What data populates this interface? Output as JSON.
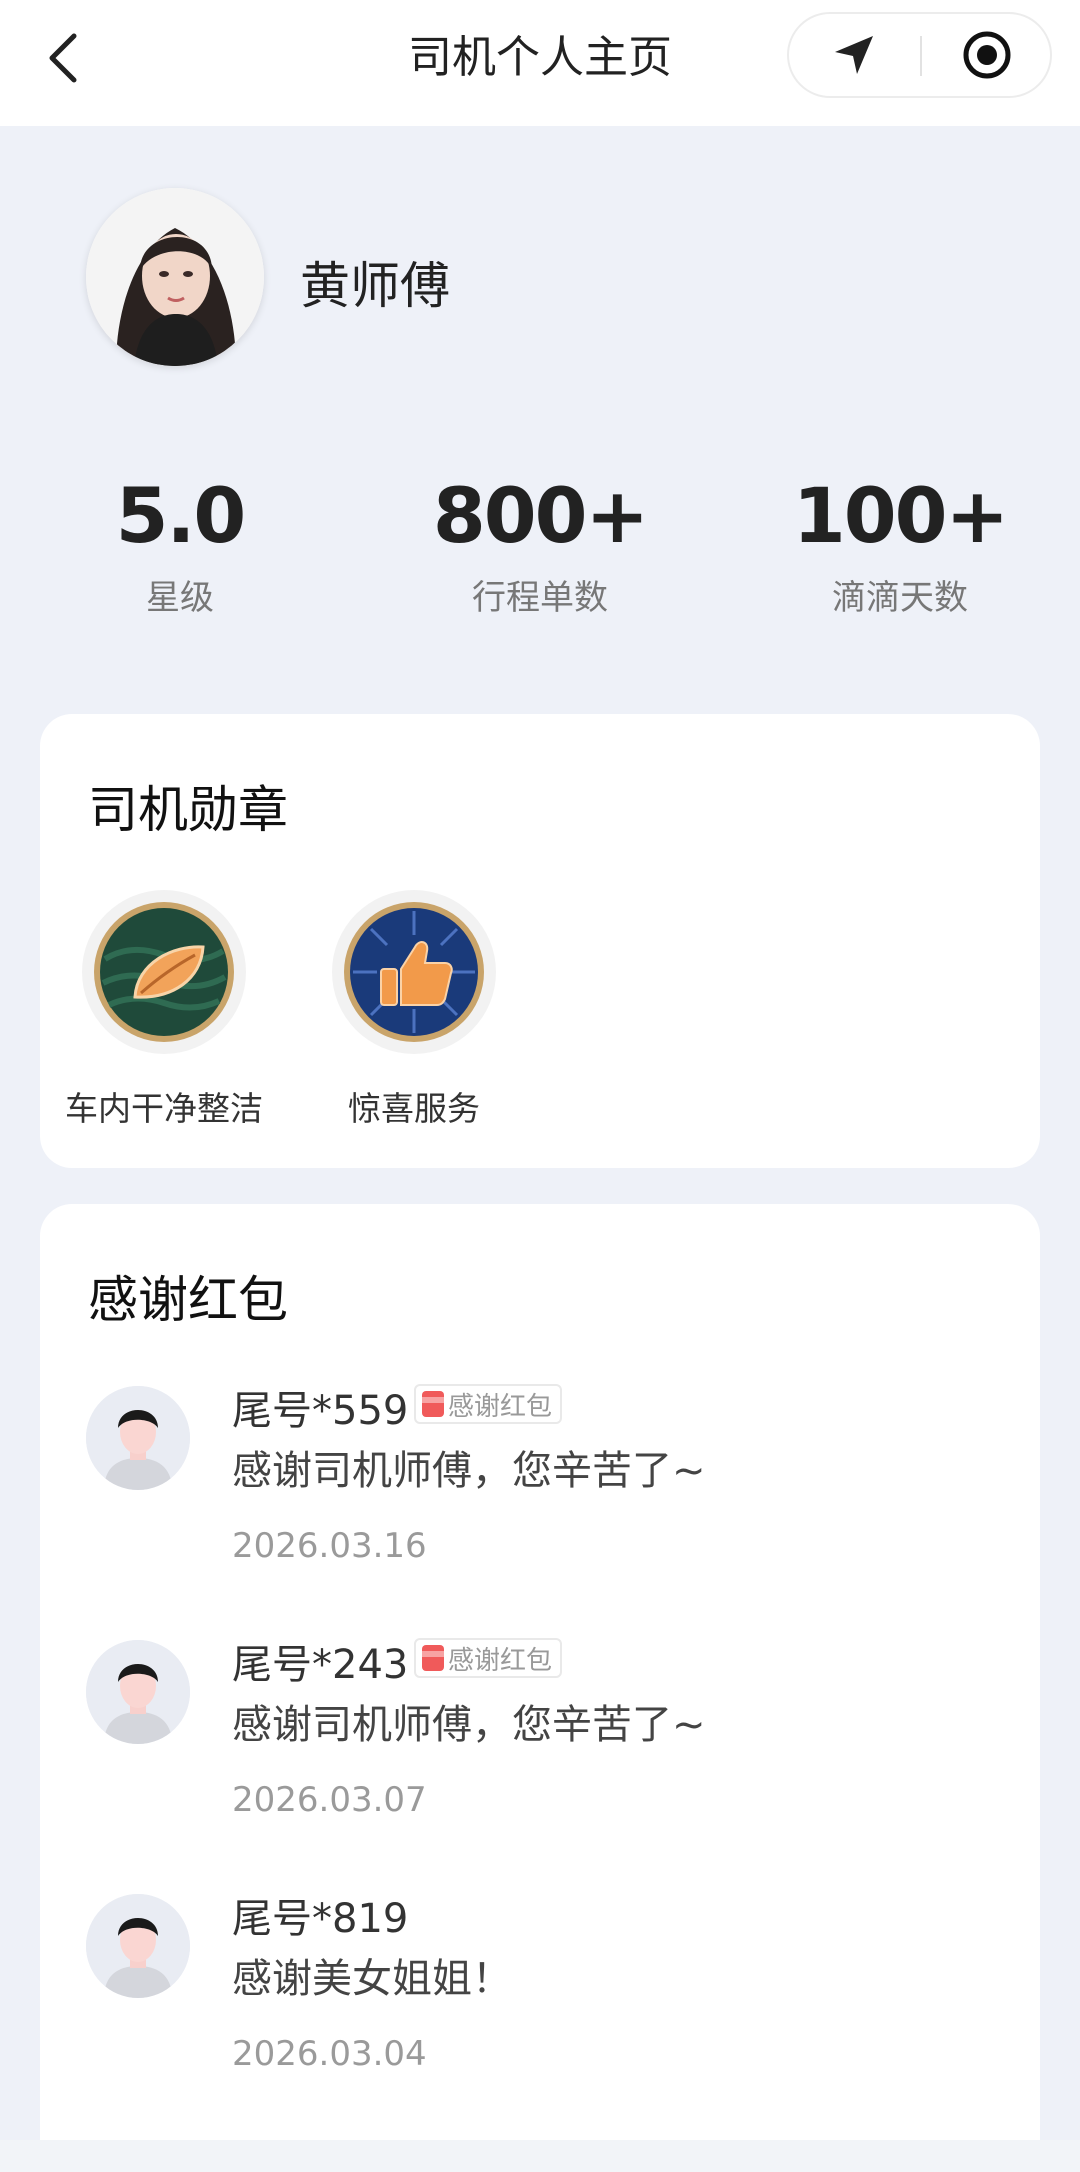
{
  "nav": {
    "title": "司机个人主页",
    "back_icon": "chevron-left-icon",
    "location_icon": "navigation-arrow-icon",
    "record_icon": "target-circle-icon"
  },
  "profile": {
    "name": "黄师傅"
  },
  "stats": [
    {
      "value": "5.0",
      "label": "星级"
    },
    {
      "value": "800+",
      "label": "行程单数"
    },
    {
      "value": "100+",
      "label": "滴滴天数"
    }
  ],
  "badges": {
    "title": "司机勋章",
    "items": [
      {
        "label": "车内干净整洁",
        "icon": "leaf-medal-icon"
      },
      {
        "label": "惊喜服务",
        "icon": "thumbs-up-medal-icon"
      }
    ]
  },
  "thanks": {
    "title": "感谢红包",
    "tag_label": "感谢红包",
    "items": [
      {
        "user": "尾号*559",
        "message": "感谢司机师傅，您辛苦了~",
        "date": "2026.03.16",
        "has_tag": true
      },
      {
        "user": "尾号*243",
        "message": "感谢司机师傅，您辛苦了~",
        "date": "2026.03.07",
        "has_tag": true
      },
      {
        "user": "尾号*819",
        "message": "感谢美女姐姐！",
        "date": "2026.03.04",
        "has_tag": false
      }
    ]
  },
  "colors": {
    "page_bg": "#EEF1F8",
    "card_bg": "#FFFFFF",
    "red_packet": "#F05A5A",
    "badge_green": "#1F4A3A",
    "badge_blue": "#1A3A7A",
    "badge_orange": "#F29A4A"
  }
}
